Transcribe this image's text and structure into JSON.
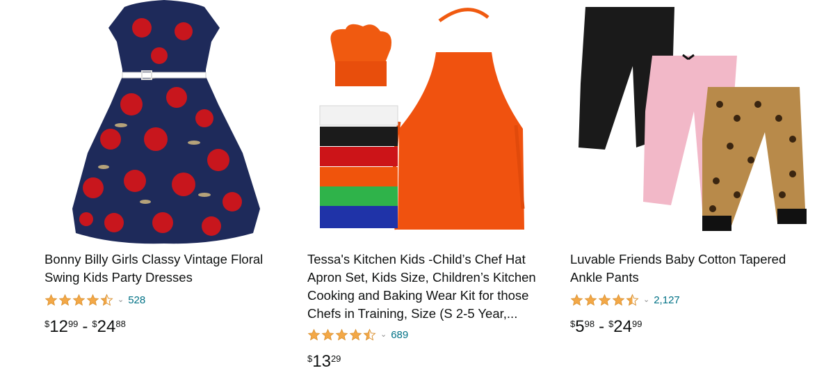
{
  "products": [
    {
      "title": "Bonny Billy Girls Classy Vintage Floral Swing Kids Party Dresses",
      "rating": 4.5,
      "review_count": "528",
      "price_low": {
        "symbol": "$",
        "whole": "12",
        "fraction": "99"
      },
      "price_high": {
        "symbol": "$",
        "whole": "24",
        "fraction": "88"
      },
      "price_separator": "-",
      "image_icon": "floral-dress-image"
    },
    {
      "title": "Tessa's Kitchen Kids -Child’s Chef Hat Apron Set, Kids Size, Children’s Kitchen Cooking and Baking Wear Kit for those Chefs in Training, Size (S 2-5 Year,...",
      "rating": 4.5,
      "review_count": "689",
      "price": {
        "symbol": "$",
        "whole": "13",
        "fraction": "29"
      },
      "image_icon": "chef-apron-set-image"
    },
    {
      "title": "Luvable Friends Baby Cotton Tapered Ankle Pants",
      "rating": 4.5,
      "review_count": "2,127",
      "price_low": {
        "symbol": "$",
        "whole": "5",
        "fraction": "98"
      },
      "price_high": {
        "symbol": "$",
        "whole": "24",
        "fraction": "99"
      },
      "price_separator": "-",
      "image_icon": "baby-pants-image"
    }
  ],
  "colors": {
    "star": "#f3a847",
    "link": "#007185",
    "text": "#0f1111"
  },
  "chevron": "⌄"
}
